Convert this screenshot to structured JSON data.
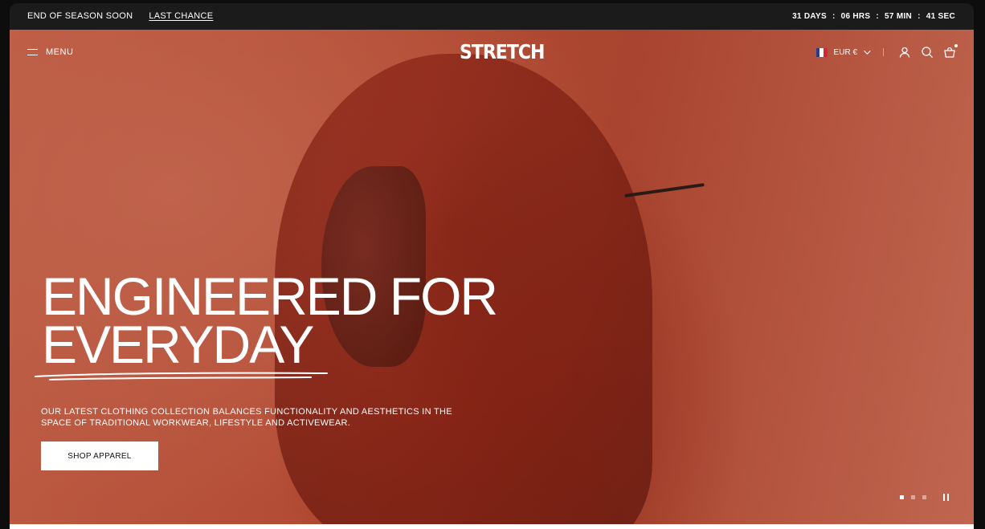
{
  "announcement": {
    "message": "END OF SEASON SOON",
    "cta": "LAST CHANCE",
    "countdown": {
      "days": "31 DAYS",
      "hours": "06 HRS",
      "minutes": "57 MIN",
      "seconds": "41 SEC",
      "separator": ":"
    }
  },
  "header": {
    "menu_label": "MENU",
    "logo": "STRETCH",
    "currency": "EUR €"
  },
  "hero": {
    "headline_line1": "ENGINEERED FOR",
    "headline_line2": "EVERYDAY",
    "subtext": "OUR LATEST CLOTHING COLLECTION BALANCES FUNCTIONALITY AND AESTHETICS IN THE SPACE OF TRADITIONAL WORKWEAR, LIFESTYLE AND ACTIVEWEAR.",
    "button_label": "SHOP APPAREL",
    "slide_count": 3,
    "active_slide": 1
  },
  "colors": {
    "background": "#0d0d0d",
    "hero_accent": "#b24a33",
    "text": "#ffffff"
  },
  "icons": [
    "menu-icon",
    "flag-france-icon",
    "chevron-down-icon",
    "account-icon",
    "search-icon",
    "cart-icon",
    "pause-icon"
  ]
}
